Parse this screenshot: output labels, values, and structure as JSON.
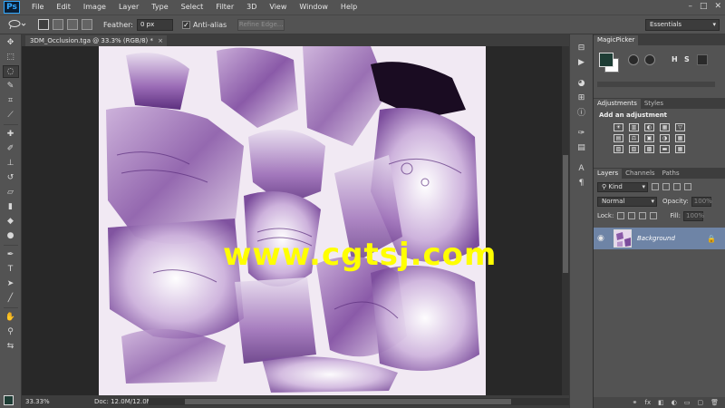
{
  "app": {
    "logo": "Ps",
    "menu": [
      "File",
      "Edit",
      "Image",
      "Layer",
      "Type",
      "Select",
      "Filter",
      "3D",
      "View",
      "Window",
      "Help"
    ],
    "window_controls": [
      "–",
      "□",
      "✕"
    ]
  },
  "options": {
    "feather_label": "Feather:",
    "feather_value": "0 px",
    "anti_alias_label": "Anti-alias",
    "anti_alias_checked": "✓",
    "refine_edge_label": "Refine Edge...",
    "workspace": "Essentials"
  },
  "document": {
    "tab_title": "3DM_Occlusion.tga @ 33.3% (RGB/8) *",
    "close": "×",
    "zoom": "33.33%",
    "doc_size": "Doc: 12.0M/12.0M",
    "watermark": "www.cgtsj.com"
  },
  "colors": {
    "foreground": "#1e3d35",
    "background": "#ffffff",
    "texture_base": "#f1e9f3",
    "texture_purple": "#6b3d8f",
    "layer_selected": "#6e84a6"
  },
  "panels": {
    "magicpicker": {
      "tab": "MagicPicker",
      "letters": [
        "H",
        "S"
      ]
    },
    "adjustments": {
      "tabs": [
        "Adjustments",
        "Styles"
      ],
      "title": "Add an adjustment",
      "icons": [
        "☀",
        "▥",
        "◐",
        "▦",
        "▽",
        "",
        "▤",
        "⚖",
        "▣",
        "◑",
        "▦",
        "",
        "▨",
        "▧",
        "▩",
        "▬",
        "▦",
        ""
      ]
    },
    "layers": {
      "tabs": [
        "Layers",
        "Channels",
        "Paths"
      ],
      "kind_label": "Kind",
      "blend_mode": "Normal",
      "opacity_label": "Opacity:",
      "opacity_value": "100%",
      "lock_label": "Lock:",
      "fill_label": "Fill:",
      "fill_value": "100%",
      "layer_name": "Background",
      "footer_icons": [
        "⚭",
        "fx",
        "◧",
        "◐",
        "▭",
        "▢",
        "🗑"
      ]
    }
  }
}
